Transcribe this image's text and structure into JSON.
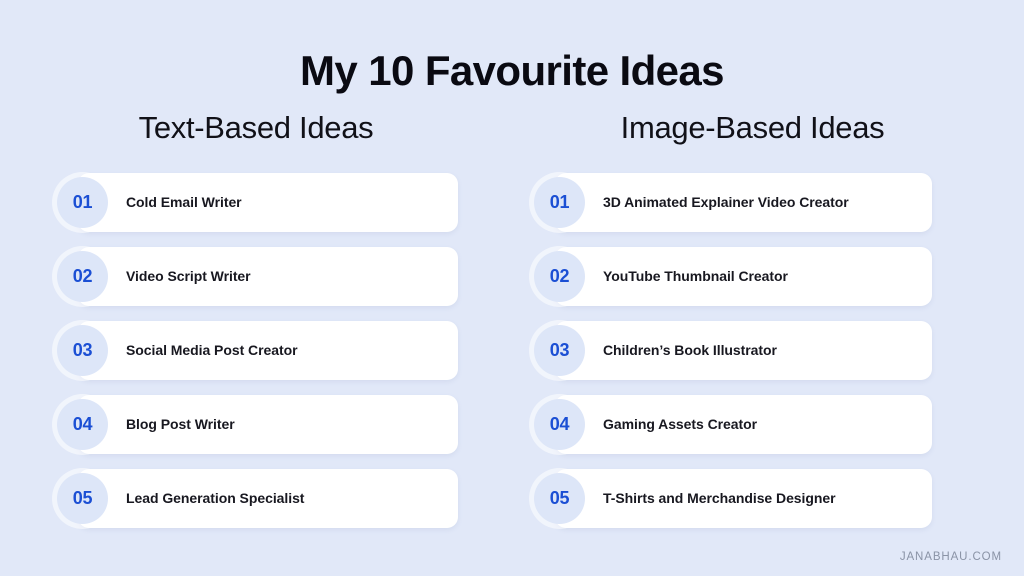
{
  "slide": {
    "title": "My 10 Favourite Ideas",
    "background_color": "#e1e8f8",
    "accent_color": "#1b4fd4",
    "card_color": "#ffffff",
    "badge_color": "#dde6f8",
    "watermark": "JANABHAU.COM"
  },
  "columns": [
    {
      "heading": "Text-Based Ideas",
      "items": [
        {
          "number": "01",
          "label": "Cold Email Writer"
        },
        {
          "number": "02",
          "label": "Video Script Writer"
        },
        {
          "number": "03",
          "label": "Social Media Post Creator"
        },
        {
          "number": "04",
          "label": "Blog Post Writer"
        },
        {
          "number": "05",
          "label": "Lead Generation Specialist"
        }
      ]
    },
    {
      "heading": "Image-Based Ideas",
      "items": [
        {
          "number": "01",
          "label": "3D Animated Explainer Video Creator"
        },
        {
          "number": "02",
          "label": "YouTube Thumbnail Creator"
        },
        {
          "number": "03",
          "label": "Children’s Book Illustrator"
        },
        {
          "number": "04",
          "label": "Gaming Assets Creator"
        },
        {
          "number": "05",
          "label": "T-Shirts and Merchandise Designer"
        }
      ]
    }
  ]
}
